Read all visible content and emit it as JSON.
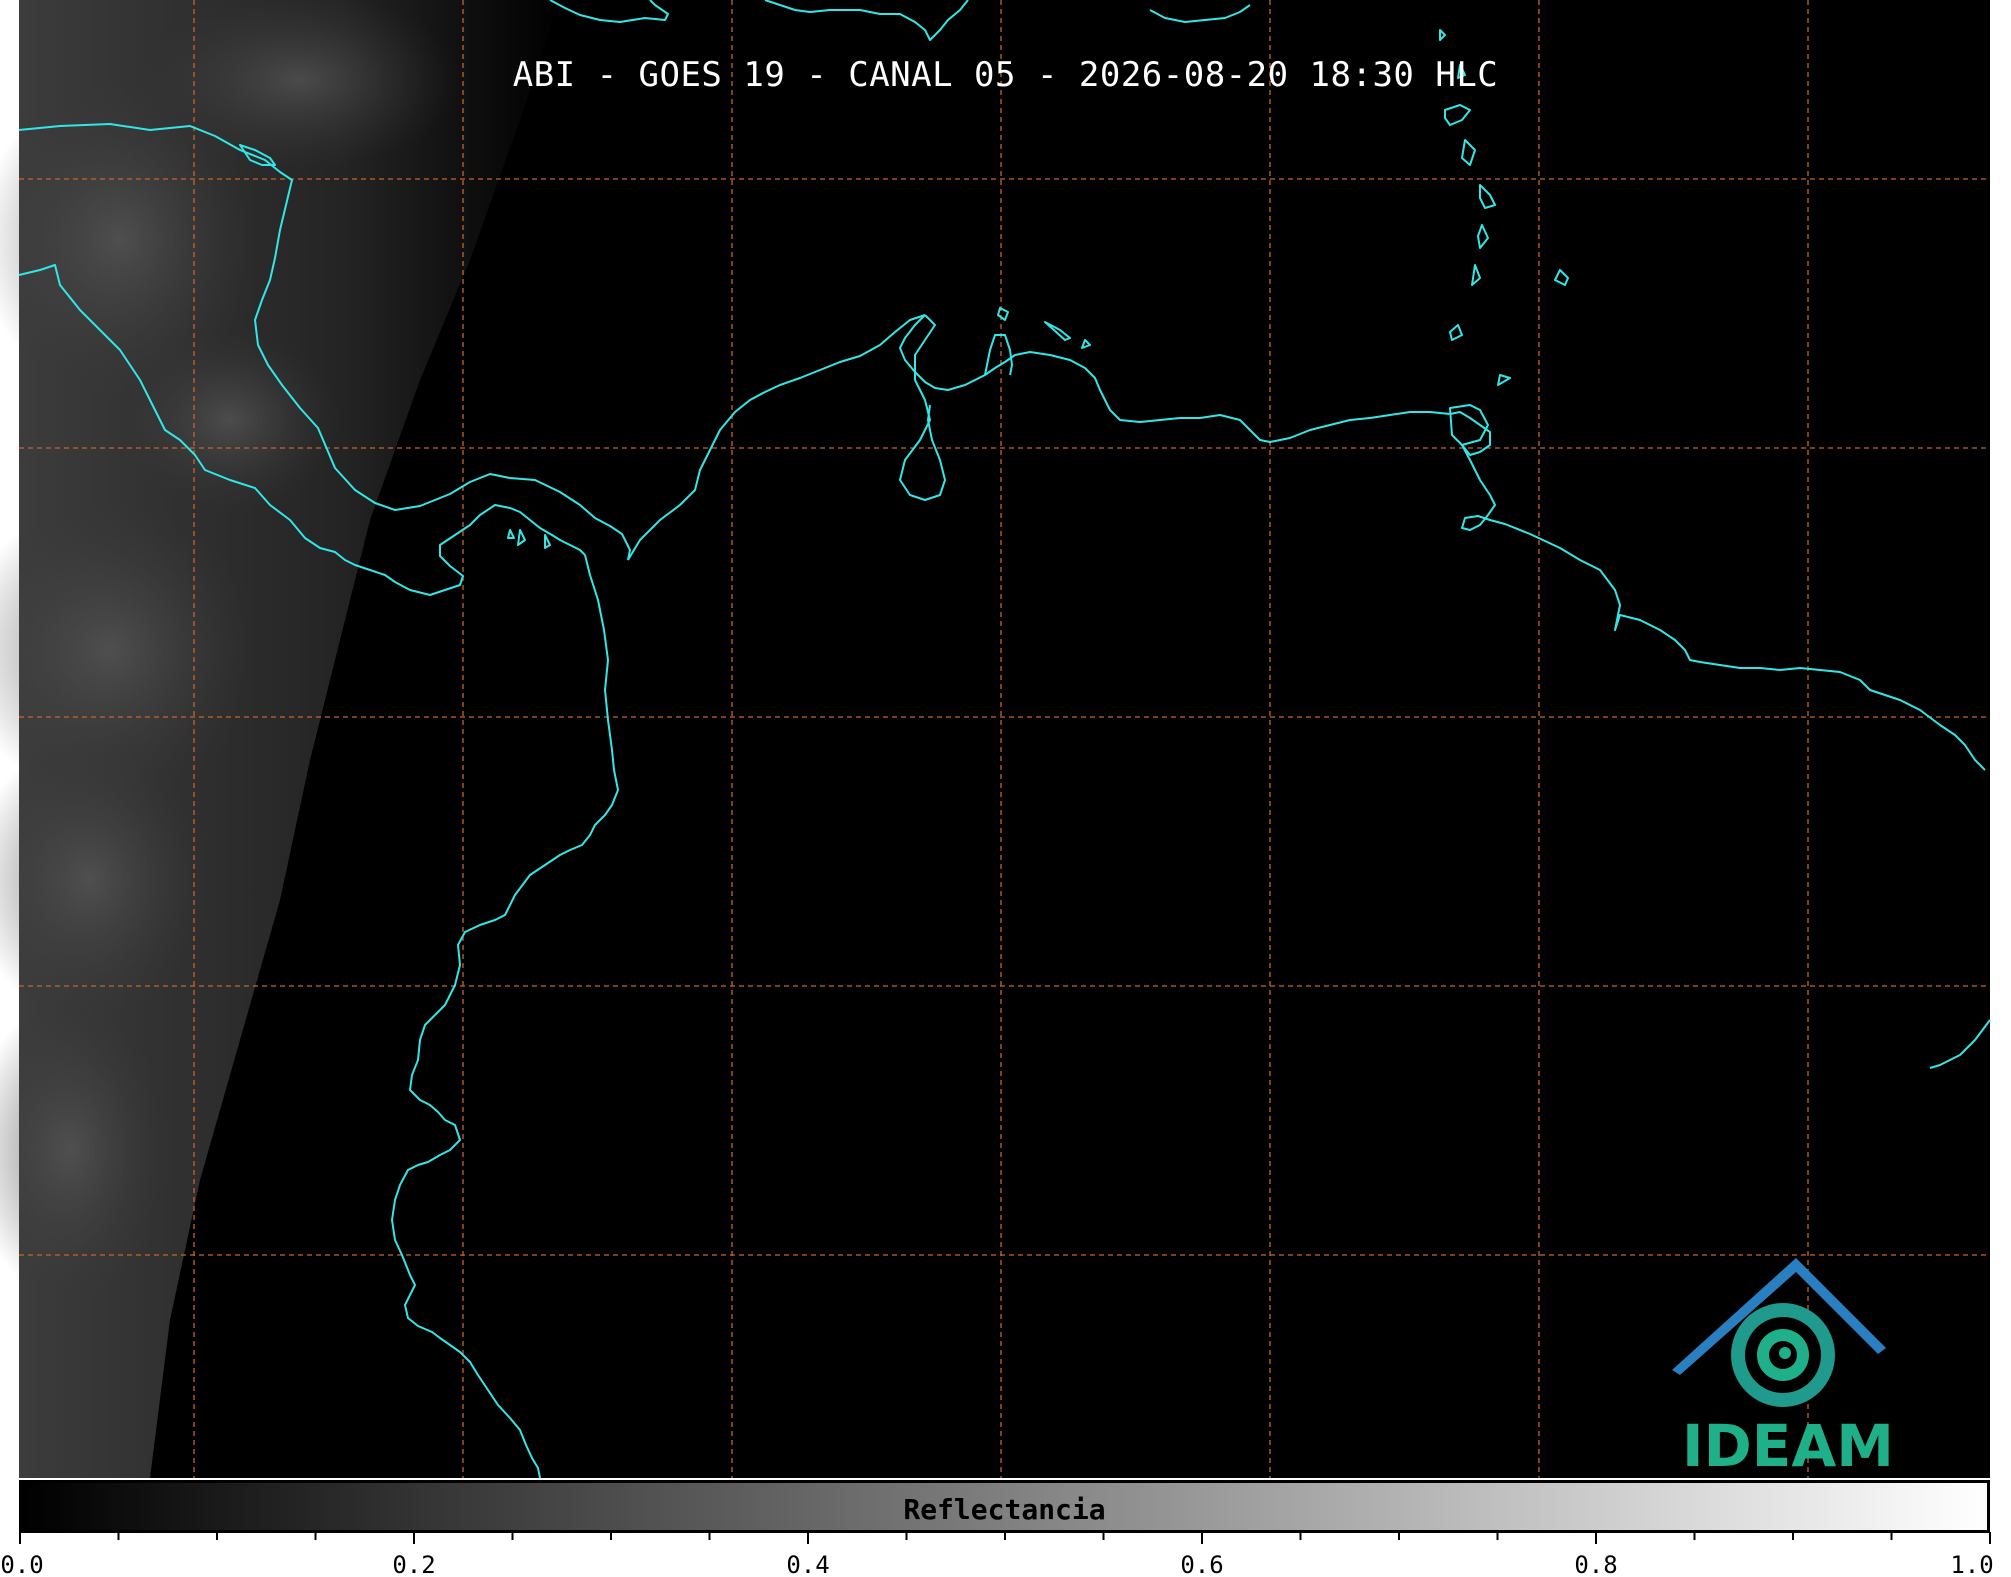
{
  "title": "ABI - GOES 19 - CANAL 05 - 2026-08-20 18:30 HLC",
  "colors": {
    "coastline": "#33e6e6",
    "gridline": "#c8642a",
    "background": "#000000",
    "logo_green": "#1fb08a",
    "logo_blue": "#2a7fc0"
  },
  "logo": {
    "text": "IDEAM",
    "icon": "ideam-logo-icon"
  },
  "colorbar": {
    "label": "Reflectancia",
    "min": 0.0,
    "max": 1.0,
    "tick_labels": [
      "0.0",
      "0.2",
      "0.4",
      "0.6",
      "0.8",
      "1.0"
    ],
    "colormap": "grayscale"
  },
  "map": {
    "gridlines": "dashed",
    "features": [
      "coastlines",
      "cloud imagery"
    ]
  }
}
